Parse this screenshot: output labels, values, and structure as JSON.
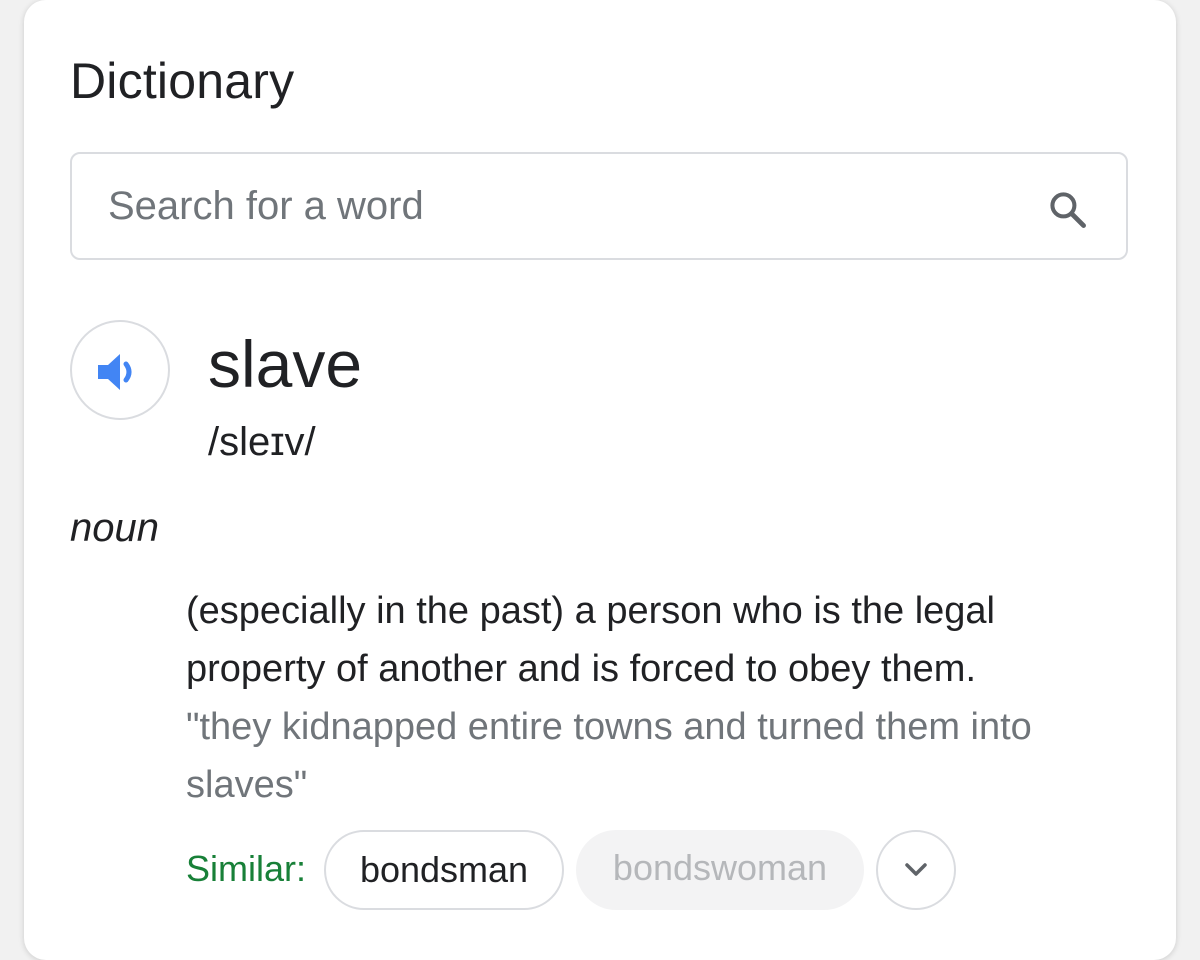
{
  "card": {
    "title": "Dictionary"
  },
  "search": {
    "placeholder": "Search for a word",
    "value": "",
    "icon": "search-icon"
  },
  "entry": {
    "speaker_icon": "speaker-icon",
    "word": "slave",
    "phonetic": "/sleɪv/",
    "part_of_speech": "noun",
    "definition": "(especially in the past) a person who is the legal property of another and is forced to obey them.",
    "example": "\"they kidnapped entire towns and turned them into slaves\""
  },
  "similar": {
    "label": "Similar:",
    "chips": [
      "bondsman",
      "bondswoman"
    ],
    "expand_icon": "chevron-down-icon"
  },
  "colors": {
    "accent_blue": "#4285f4",
    "similar_green": "#188038",
    "text_primary": "#202124",
    "text_secondary": "#70757a",
    "border": "#dadce0"
  }
}
